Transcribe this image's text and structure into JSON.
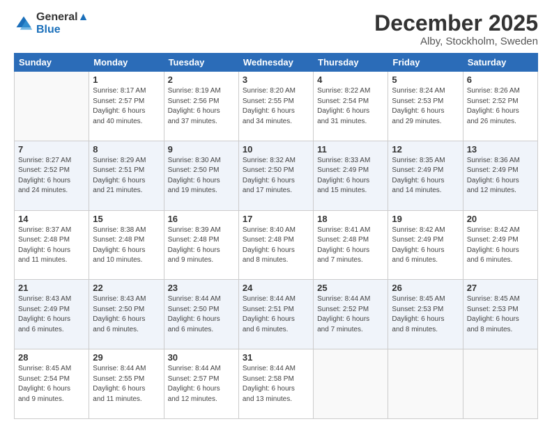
{
  "logo": {
    "line1": "General",
    "line2": "Blue"
  },
  "title": "December 2025",
  "subtitle": "Alby, Stockholm, Sweden",
  "days_header": [
    "Sunday",
    "Monday",
    "Tuesday",
    "Wednesday",
    "Thursday",
    "Friday",
    "Saturday"
  ],
  "weeks": [
    [
      {
        "num": "",
        "info": ""
      },
      {
        "num": "1",
        "info": "Sunrise: 8:17 AM\nSunset: 2:57 PM\nDaylight: 6 hours\nand 40 minutes."
      },
      {
        "num": "2",
        "info": "Sunrise: 8:19 AM\nSunset: 2:56 PM\nDaylight: 6 hours\nand 37 minutes."
      },
      {
        "num": "3",
        "info": "Sunrise: 8:20 AM\nSunset: 2:55 PM\nDaylight: 6 hours\nand 34 minutes."
      },
      {
        "num": "4",
        "info": "Sunrise: 8:22 AM\nSunset: 2:54 PM\nDaylight: 6 hours\nand 31 minutes."
      },
      {
        "num": "5",
        "info": "Sunrise: 8:24 AM\nSunset: 2:53 PM\nDaylight: 6 hours\nand 29 minutes."
      },
      {
        "num": "6",
        "info": "Sunrise: 8:26 AM\nSunset: 2:52 PM\nDaylight: 6 hours\nand 26 minutes."
      }
    ],
    [
      {
        "num": "7",
        "info": "Sunrise: 8:27 AM\nSunset: 2:52 PM\nDaylight: 6 hours\nand 24 minutes."
      },
      {
        "num": "8",
        "info": "Sunrise: 8:29 AM\nSunset: 2:51 PM\nDaylight: 6 hours\nand 21 minutes."
      },
      {
        "num": "9",
        "info": "Sunrise: 8:30 AM\nSunset: 2:50 PM\nDaylight: 6 hours\nand 19 minutes."
      },
      {
        "num": "10",
        "info": "Sunrise: 8:32 AM\nSunset: 2:50 PM\nDaylight: 6 hours\nand 17 minutes."
      },
      {
        "num": "11",
        "info": "Sunrise: 8:33 AM\nSunset: 2:49 PM\nDaylight: 6 hours\nand 15 minutes."
      },
      {
        "num": "12",
        "info": "Sunrise: 8:35 AM\nSunset: 2:49 PM\nDaylight: 6 hours\nand 14 minutes."
      },
      {
        "num": "13",
        "info": "Sunrise: 8:36 AM\nSunset: 2:49 PM\nDaylight: 6 hours\nand 12 minutes."
      }
    ],
    [
      {
        "num": "14",
        "info": "Sunrise: 8:37 AM\nSunset: 2:48 PM\nDaylight: 6 hours\nand 11 minutes."
      },
      {
        "num": "15",
        "info": "Sunrise: 8:38 AM\nSunset: 2:48 PM\nDaylight: 6 hours\nand 10 minutes."
      },
      {
        "num": "16",
        "info": "Sunrise: 8:39 AM\nSunset: 2:48 PM\nDaylight: 6 hours\nand 9 minutes."
      },
      {
        "num": "17",
        "info": "Sunrise: 8:40 AM\nSunset: 2:48 PM\nDaylight: 6 hours\nand 8 minutes."
      },
      {
        "num": "18",
        "info": "Sunrise: 8:41 AM\nSunset: 2:48 PM\nDaylight: 6 hours\nand 7 minutes."
      },
      {
        "num": "19",
        "info": "Sunrise: 8:42 AM\nSunset: 2:49 PM\nDaylight: 6 hours\nand 6 minutes."
      },
      {
        "num": "20",
        "info": "Sunrise: 8:42 AM\nSunset: 2:49 PM\nDaylight: 6 hours\nand 6 minutes."
      }
    ],
    [
      {
        "num": "21",
        "info": "Sunrise: 8:43 AM\nSunset: 2:49 PM\nDaylight: 6 hours\nand 6 minutes."
      },
      {
        "num": "22",
        "info": "Sunrise: 8:43 AM\nSunset: 2:50 PM\nDaylight: 6 hours\nand 6 minutes."
      },
      {
        "num": "23",
        "info": "Sunrise: 8:44 AM\nSunset: 2:50 PM\nDaylight: 6 hours\nand 6 minutes."
      },
      {
        "num": "24",
        "info": "Sunrise: 8:44 AM\nSunset: 2:51 PM\nDaylight: 6 hours\nand 6 minutes."
      },
      {
        "num": "25",
        "info": "Sunrise: 8:44 AM\nSunset: 2:52 PM\nDaylight: 6 hours\nand 7 minutes."
      },
      {
        "num": "26",
        "info": "Sunrise: 8:45 AM\nSunset: 2:53 PM\nDaylight: 6 hours\nand 8 minutes."
      },
      {
        "num": "27",
        "info": "Sunrise: 8:45 AM\nSunset: 2:53 PM\nDaylight: 6 hours\nand 8 minutes."
      }
    ],
    [
      {
        "num": "28",
        "info": "Sunrise: 8:45 AM\nSunset: 2:54 PM\nDaylight: 6 hours\nand 9 minutes."
      },
      {
        "num": "29",
        "info": "Sunrise: 8:44 AM\nSunset: 2:55 PM\nDaylight: 6 hours\nand 11 minutes."
      },
      {
        "num": "30",
        "info": "Sunrise: 8:44 AM\nSunset: 2:57 PM\nDaylight: 6 hours\nand 12 minutes."
      },
      {
        "num": "31",
        "info": "Sunrise: 8:44 AM\nSunset: 2:58 PM\nDaylight: 6 hours\nand 13 minutes."
      },
      {
        "num": "",
        "info": ""
      },
      {
        "num": "",
        "info": ""
      },
      {
        "num": "",
        "info": ""
      }
    ]
  ]
}
